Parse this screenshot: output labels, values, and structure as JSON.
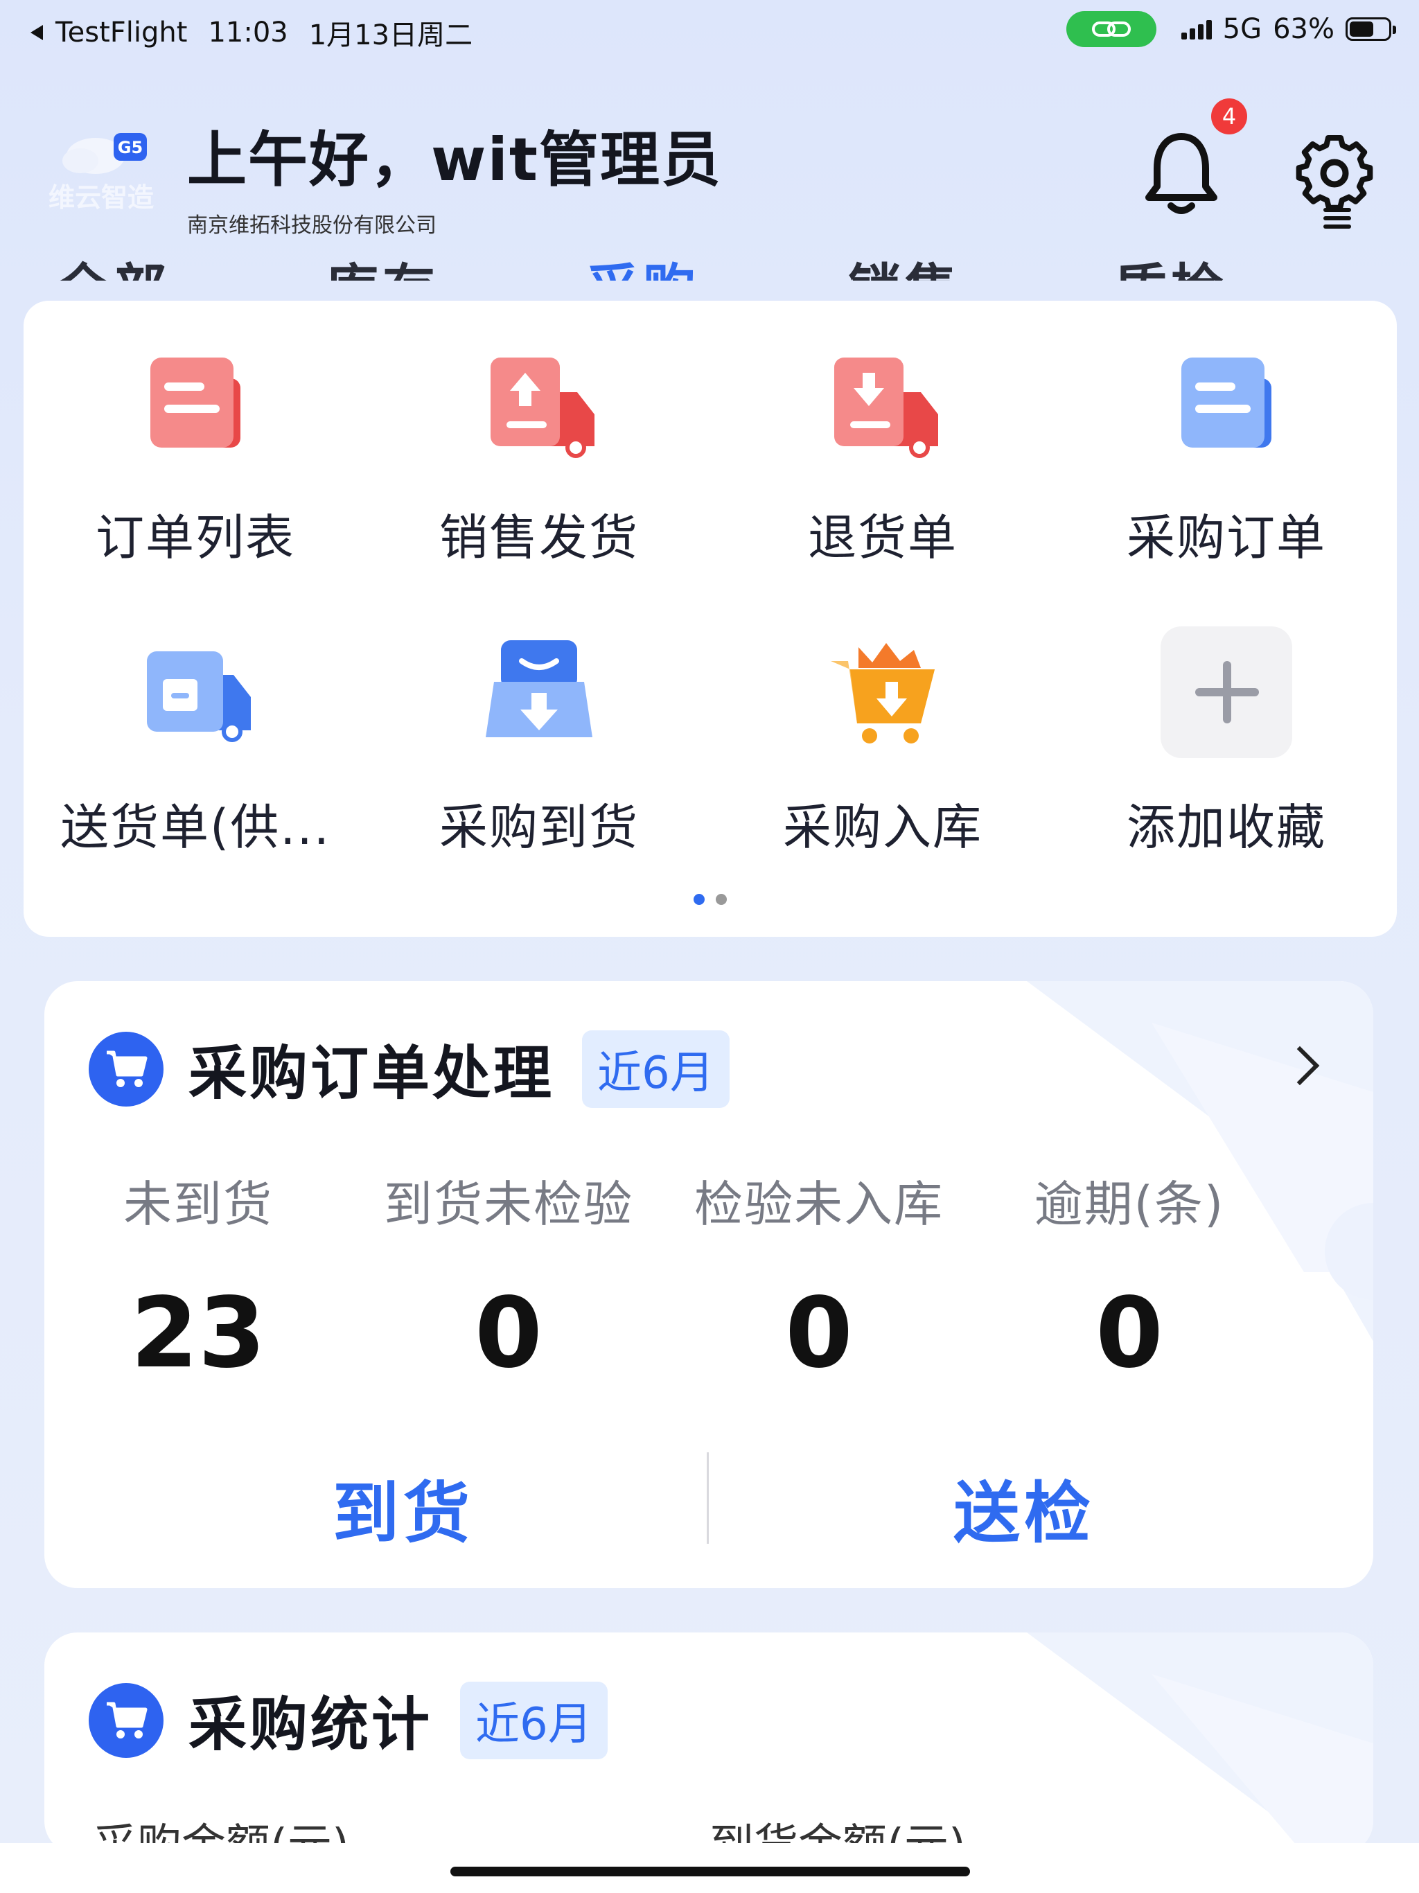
{
  "status_bar": {
    "back_app": "TestFlight",
    "time": "11:03",
    "date": "1月13日周二",
    "network": "5G",
    "battery": "63%",
    "battery_level": 0.63
  },
  "header": {
    "logo_badge": "G5",
    "logo_text": "维云智造",
    "greeting": "上午好，wit管理员",
    "company": "南京维拓科技股份有限公司",
    "notification_count": "4"
  },
  "tabs": [
    {
      "label": "全部"
    },
    {
      "label": "库存"
    },
    {
      "label": "采购",
      "active": true
    },
    {
      "label": "销售"
    },
    {
      "label": "质检"
    }
  ],
  "quick_access": {
    "items": [
      {
        "label": "订单列表",
        "icon": "order-list-icon"
      },
      {
        "label": "销售发货",
        "icon": "sales-shipping-icon"
      },
      {
        "label": "退货单",
        "icon": "return-order-icon"
      },
      {
        "label": "采购订单",
        "icon": "purchase-order-icon"
      },
      {
        "label": "送货单(供...",
        "icon": "delivery-note-icon"
      },
      {
        "label": "采购到货",
        "icon": "purchase-arrival-icon"
      },
      {
        "label": "采购入库",
        "icon": "purchase-inbound-icon"
      },
      {
        "label": "添加收藏",
        "icon": "add-favorite-icon"
      }
    ],
    "page_count": 2,
    "current_page": 1
  },
  "purchase_order_card": {
    "title": "采购订单处理",
    "period": "近6月",
    "stats": [
      {
        "label": "未到货",
        "value": "23"
      },
      {
        "label": "到货未检验",
        "value": "0"
      },
      {
        "label": "检验未入库",
        "value": "0"
      },
      {
        "label": "逾期(条)",
        "value": "0"
      }
    ],
    "actions": {
      "arrival": "到货",
      "inspection": "送检"
    }
  },
  "purchase_stats_card": {
    "title": "采购统计",
    "period": "近6月",
    "labels": [
      "采购金额(元)",
      "到货金额(元)"
    ]
  },
  "colors": {
    "accent": "#2f6bf0",
    "background": "#dde6fb",
    "badge": "#f03a3a",
    "red_icon": "#f25555",
    "blue_icon": "#4b86f5",
    "orange_icon": "#f7a21e"
  }
}
